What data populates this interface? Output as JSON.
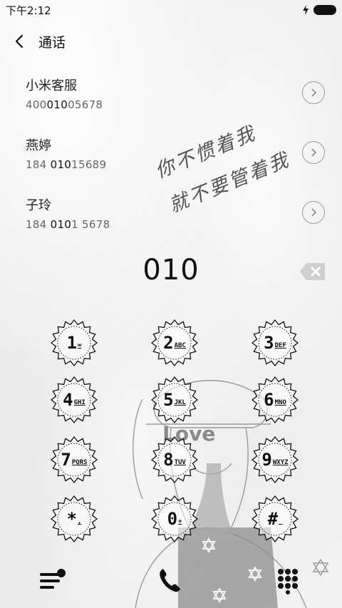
{
  "status_bar": {
    "time": "下午2:12"
  },
  "header": {
    "title": "通话"
  },
  "contacts": [
    {
      "name": "小米客服",
      "number_pre": "400",
      "number_hl": "010",
      "number_post": "05678"
    },
    {
      "name": "燕婷",
      "number_pre": "184 ",
      "number_hl": "010",
      "number_post": "15689"
    },
    {
      "name": "子玲",
      "number_pre": "184 ",
      "number_hl": "010",
      "number_post": "1 5678"
    }
  ],
  "handwriting": {
    "line1": "你不惯着我",
    "line2": "就不要管着我"
  },
  "dialed_number": "010",
  "keypad": [
    {
      "digit": "1",
      "letters": "∞"
    },
    {
      "digit": "2",
      "letters": "ABC"
    },
    {
      "digit": "3",
      "letters": "DEF"
    },
    {
      "digit": "4",
      "letters": "GHI"
    },
    {
      "digit": "5",
      "letters": "JKL"
    },
    {
      "digit": "6",
      "letters": "MNO"
    },
    {
      "digit": "7",
      "letters": "PQRS"
    },
    {
      "digit": "8",
      "letters": "TUV"
    },
    {
      "digit": "9",
      "letters": "WXYZ"
    },
    {
      "digit": "*",
      "letters": ","
    },
    {
      "digit": "0",
      "letters": "+"
    },
    {
      "digit": "#",
      "letters": "_"
    }
  ],
  "illustration": {
    "text": "Love"
  },
  "icons": {
    "back": "chevron-left-icon",
    "info": "chevron-right-icon",
    "backspace": "backspace-icon",
    "menu": "menu-icon",
    "call": "phone-icon",
    "dialpad": "dialpad-icon"
  }
}
